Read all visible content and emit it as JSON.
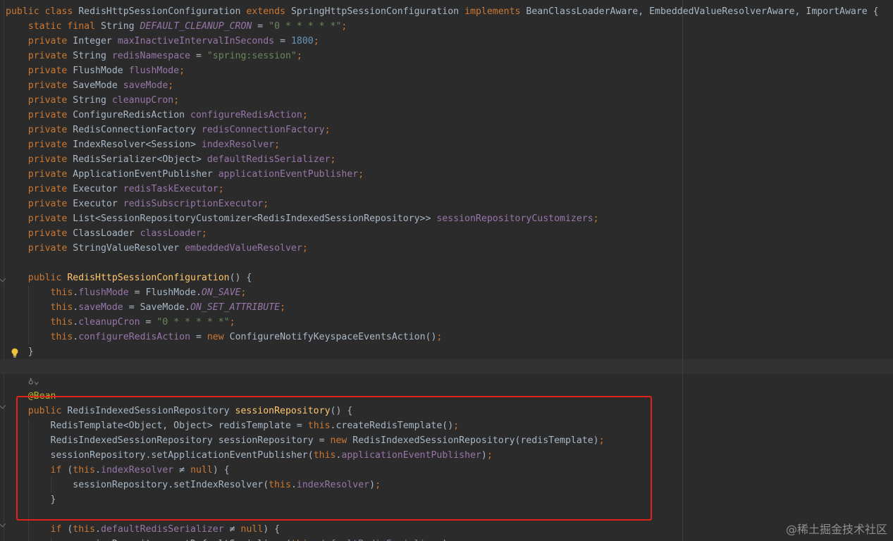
{
  "editor": {
    "watermark": "@稀土掘金技术社区",
    "highlight_color": "#e0221c",
    "colors": {
      "background": "#2b2b2b",
      "keyword": "#cc7832",
      "field": "#9876aa",
      "string": "#6a8759",
      "number": "#6897bb",
      "method": "#ffc66d",
      "annotation": "#bbb529",
      "plain": "#a9b7c6"
    },
    "icons": {
      "bulb": "lightbulb-icon",
      "fold": "fold-arrow-icon",
      "hint": "inlay-hint-icon"
    },
    "lines": [
      [
        {
          "c": "kw",
          "s": "public class "
        },
        {
          "c": "pl",
          "s": "RedisHttpSessionConfiguration "
        },
        {
          "c": "kw",
          "s": "extends "
        },
        {
          "c": "pl",
          "s": "SpringHttpSessionConfiguration "
        },
        {
          "c": "kw",
          "s": "implements "
        },
        {
          "c": "pl",
          "s": "BeanClassLoaderAware, EmbeddedValueResolverAware, ImportAware {"
        }
      ],
      [
        {
          "c": "kw",
          "s": "    static final "
        },
        {
          "c": "pl",
          "s": "String "
        },
        {
          "c": "cst",
          "s": "DEFAULT_CLEANUP_CRON"
        },
        {
          "c": "pl",
          "s": " = "
        },
        {
          "c": "str",
          "s": "\"0 * * * * *\""
        },
        {
          "c": "kw",
          "s": ";"
        }
      ],
      [
        {
          "c": "kw",
          "s": "    private "
        },
        {
          "c": "pl",
          "s": "Integer "
        },
        {
          "c": "fld",
          "s": "maxInactiveIntervalInSeconds"
        },
        {
          "c": "pl",
          "s": " = "
        },
        {
          "c": "num",
          "s": "1800"
        },
        {
          "c": "kw",
          "s": ";"
        }
      ],
      [
        {
          "c": "kw",
          "s": "    private "
        },
        {
          "c": "pl",
          "s": "String "
        },
        {
          "c": "fld",
          "s": "redisNamespace"
        },
        {
          "c": "pl",
          "s": " = "
        },
        {
          "c": "str",
          "s": "\"spring:session\""
        },
        {
          "c": "kw",
          "s": ";"
        }
      ],
      [
        {
          "c": "kw",
          "s": "    private "
        },
        {
          "c": "pl",
          "s": "FlushMode "
        },
        {
          "c": "fld",
          "s": "flushMode"
        },
        {
          "c": "kw",
          "s": ";"
        }
      ],
      [
        {
          "c": "kw",
          "s": "    private "
        },
        {
          "c": "pl",
          "s": "SaveMode "
        },
        {
          "c": "fld",
          "s": "saveMode"
        },
        {
          "c": "kw",
          "s": ";"
        }
      ],
      [
        {
          "c": "kw",
          "s": "    private "
        },
        {
          "c": "pl",
          "s": "String "
        },
        {
          "c": "fld",
          "s": "cleanupCron"
        },
        {
          "c": "kw",
          "s": ";"
        }
      ],
      [
        {
          "c": "kw",
          "s": "    private "
        },
        {
          "c": "pl",
          "s": "ConfigureRedisAction "
        },
        {
          "c": "fld",
          "s": "configureRedisAction"
        },
        {
          "c": "kw",
          "s": ";"
        }
      ],
      [
        {
          "c": "kw",
          "s": "    private "
        },
        {
          "c": "pl",
          "s": "RedisConnectionFactory "
        },
        {
          "c": "fld",
          "s": "redisConnectionFactory"
        },
        {
          "c": "kw",
          "s": ";"
        }
      ],
      [
        {
          "c": "kw",
          "s": "    private "
        },
        {
          "c": "pl",
          "s": "IndexResolver<Session> "
        },
        {
          "c": "fld",
          "s": "indexResolver"
        },
        {
          "c": "kw",
          "s": ";"
        }
      ],
      [
        {
          "c": "kw",
          "s": "    private "
        },
        {
          "c": "pl",
          "s": "RedisSerializer<Object> "
        },
        {
          "c": "fld",
          "s": "defaultRedisSerializer"
        },
        {
          "c": "kw",
          "s": ";"
        }
      ],
      [
        {
          "c": "kw",
          "s": "    private "
        },
        {
          "c": "pl",
          "s": "ApplicationEventPublisher "
        },
        {
          "c": "fld",
          "s": "applicationEventPublisher"
        },
        {
          "c": "kw",
          "s": ";"
        }
      ],
      [
        {
          "c": "kw",
          "s": "    private "
        },
        {
          "c": "pl",
          "s": "Executor "
        },
        {
          "c": "fld",
          "s": "redisTaskExecutor"
        },
        {
          "c": "kw",
          "s": ";"
        }
      ],
      [
        {
          "c": "kw",
          "s": "    private "
        },
        {
          "c": "pl",
          "s": "Executor "
        },
        {
          "c": "fld",
          "s": "redisSubscriptionExecutor"
        },
        {
          "c": "kw",
          "s": ";"
        }
      ],
      [
        {
          "c": "kw",
          "s": "    private "
        },
        {
          "c": "pl",
          "s": "List<SessionRepositoryCustomizer<RedisIndexedSessionRepository>> "
        },
        {
          "c": "fld",
          "s": "sessionRepositoryCustomizers"
        },
        {
          "c": "kw",
          "s": ";"
        }
      ],
      [
        {
          "c": "kw",
          "s": "    private "
        },
        {
          "c": "pl",
          "s": "ClassLoader "
        },
        {
          "c": "fld",
          "s": "classLoader"
        },
        {
          "c": "kw",
          "s": ";"
        }
      ],
      [
        {
          "c": "kw",
          "s": "    private "
        },
        {
          "c": "pl",
          "s": "StringValueResolver "
        },
        {
          "c": "fld",
          "s": "embeddedValueResolver"
        },
        {
          "c": "kw",
          "s": ";"
        }
      ],
      [],
      [
        {
          "c": "kw",
          "s": "    public "
        },
        {
          "c": "mth",
          "s": "RedisHttpSessionConfiguration"
        },
        {
          "c": "pl",
          "s": "() {"
        }
      ],
      [
        {
          "c": "kw",
          "s": "        this"
        },
        {
          "c": "pl",
          "s": "."
        },
        {
          "c": "fld",
          "s": "flushMode"
        },
        {
          "c": "pl",
          "s": " = FlushMode."
        },
        {
          "c": "cst",
          "s": "ON_SAVE"
        },
        {
          "c": "kw",
          "s": ";"
        }
      ],
      [
        {
          "c": "kw",
          "s": "        this"
        },
        {
          "c": "pl",
          "s": "."
        },
        {
          "c": "fld",
          "s": "saveMode"
        },
        {
          "c": "pl",
          "s": " = SaveMode."
        },
        {
          "c": "cst",
          "s": "ON_SET_ATTRIBUTE"
        },
        {
          "c": "kw",
          "s": ";"
        }
      ],
      [
        {
          "c": "kw",
          "s": "        this"
        },
        {
          "c": "pl",
          "s": "."
        },
        {
          "c": "fld",
          "s": "cleanupCron"
        },
        {
          "c": "pl",
          "s": " = "
        },
        {
          "c": "str",
          "s": "\"0 * * * * *\""
        },
        {
          "c": "kw",
          "s": ";"
        }
      ],
      [
        {
          "c": "kw",
          "s": "        this"
        },
        {
          "c": "pl",
          "s": "."
        },
        {
          "c": "fld",
          "s": "configureRedisAction"
        },
        {
          "c": "pl",
          "s": " = "
        },
        {
          "c": "kw",
          "s": "new "
        },
        {
          "c": "pl",
          "s": "ConfigureNotifyKeyspaceEventsAction()"
        },
        {
          "c": "kw",
          "s": ";"
        }
      ],
      [
        {
          "c": "pl",
          "s": "    }"
        }
      ],
      [],
      [
        {
          "c": "hint",
          "s": "    ♁⌄"
        }
      ],
      [
        {
          "c": "ann",
          "s": "    @Bean"
        }
      ],
      [
        {
          "c": "kw",
          "s": "    public "
        },
        {
          "c": "pl",
          "s": "RedisIndexedSessionRepository "
        },
        {
          "c": "mth",
          "s": "sessionRepository"
        },
        {
          "c": "pl",
          "s": "() {"
        }
      ],
      [
        {
          "c": "pl",
          "s": "        RedisTemplate<Object, Object> redisTemplate = "
        },
        {
          "c": "kw",
          "s": "this"
        },
        {
          "c": "pl",
          "s": ".createRedisTemplate()"
        },
        {
          "c": "kw",
          "s": ";"
        }
      ],
      [
        {
          "c": "pl",
          "s": "        RedisIndexedSessionRepository sessionRepository = "
        },
        {
          "c": "kw",
          "s": "new "
        },
        {
          "c": "pl",
          "s": "RedisIndexedSessionRepository(redisTemplate)"
        },
        {
          "c": "kw",
          "s": ";"
        }
      ],
      [
        {
          "c": "pl",
          "s": "        sessionRepository.setApplicationEventPublisher("
        },
        {
          "c": "kw",
          "s": "this"
        },
        {
          "c": "pl",
          "s": "."
        },
        {
          "c": "fld",
          "s": "applicationEventPublisher"
        },
        {
          "c": "pl",
          "s": ")"
        },
        {
          "c": "kw",
          "s": ";"
        }
      ],
      [
        {
          "c": "kw",
          "s": "        if "
        },
        {
          "c": "pl",
          "s": "("
        },
        {
          "c": "kw",
          "s": "this"
        },
        {
          "c": "pl",
          "s": "."
        },
        {
          "c": "fld",
          "s": "indexResolver"
        },
        {
          "c": "pl",
          "s": " ≠ "
        },
        {
          "c": "kw",
          "s": "null"
        },
        {
          "c": "pl",
          "s": ") {"
        }
      ],
      [
        {
          "c": "pl",
          "s": "            sessionRepository.setIndexResolver("
        },
        {
          "c": "kw",
          "s": "this"
        },
        {
          "c": "pl",
          "s": "."
        },
        {
          "c": "fld",
          "s": "indexResolver"
        },
        {
          "c": "pl",
          "s": ")"
        },
        {
          "c": "kw",
          "s": ";"
        }
      ],
      [
        {
          "c": "pl",
          "s": "        }"
        }
      ],
      [],
      [
        {
          "c": "kw",
          "s": "        if "
        },
        {
          "c": "pl",
          "s": "("
        },
        {
          "c": "kw",
          "s": "this"
        },
        {
          "c": "pl",
          "s": "."
        },
        {
          "c": "fld",
          "s": "defaultRedisSerializer"
        },
        {
          "c": "pl",
          "s": " ≠ "
        },
        {
          "c": "kw",
          "s": "null"
        },
        {
          "c": "pl",
          "s": ") {"
        }
      ],
      [
        {
          "c": "pl",
          "s": "            sessionRepository.setDefaultSerializer("
        },
        {
          "c": "kw",
          "s": "this"
        },
        {
          "c": "pl",
          "s": "."
        },
        {
          "c": "fld",
          "s": "defaultRedisSerializer"
        },
        {
          "c": "pl",
          "s": ")"
        },
        {
          "c": "kw",
          "s": ";"
        }
      ]
    ]
  }
}
